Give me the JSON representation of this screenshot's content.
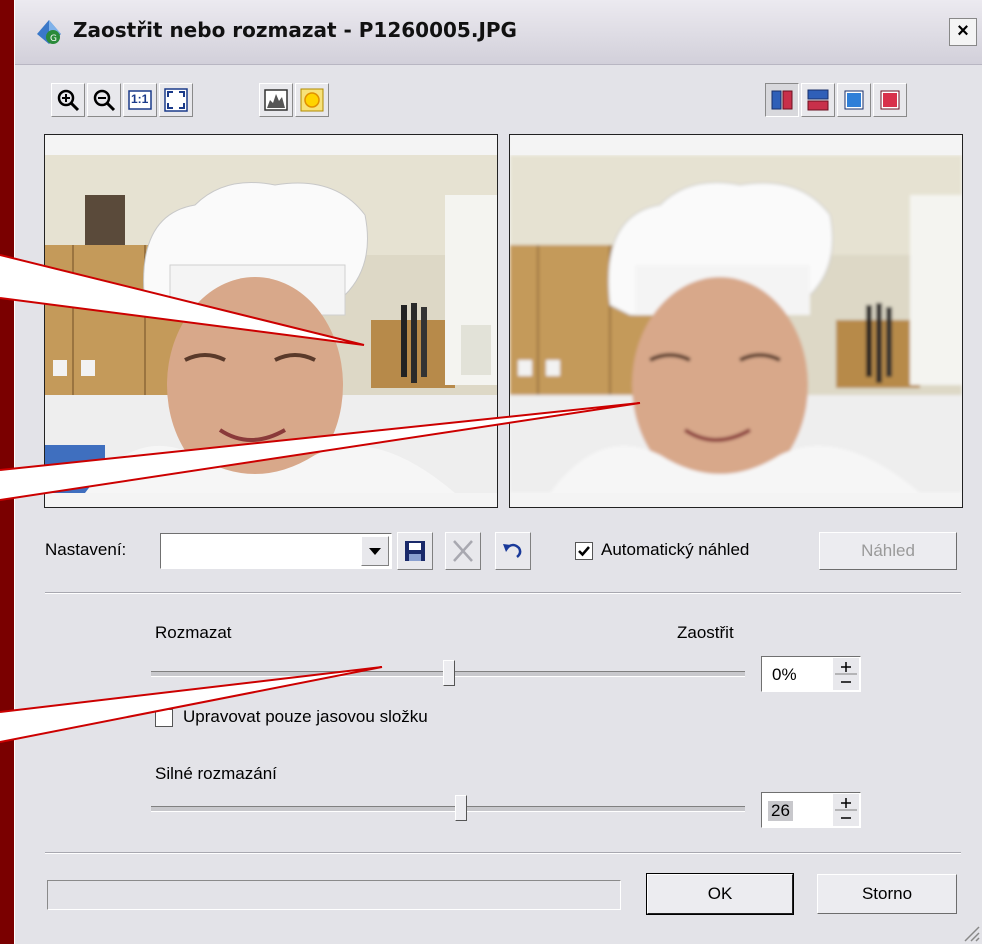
{
  "window": {
    "title": "Zaostřit nebo rozmazat - P1260005.JPG",
    "close_glyph": "×"
  },
  "toolbar": {
    "zoom_in_icon": "zoom-in-icon",
    "zoom_out_icon": "zoom-out-icon",
    "actual_size_label": "1:1",
    "fit_icon": "fit-to-window-icon",
    "histogram_icon": "histogram-icon",
    "sun_icon": "sun-icon",
    "view_icons": [
      "split-vertical-icon",
      "split-horizontal-icon",
      "single-view-blue-icon",
      "single-view-red-icon"
    ]
  },
  "settings": {
    "label": "Nastavení:",
    "preset_value": "",
    "auto_preview_label": "Automatický náhled",
    "auto_preview_checked": true,
    "preview_button": "Náhled"
  },
  "sharpen": {
    "left_label": "Rozmazat",
    "right_label": "Zaostřit",
    "value": "0%",
    "luminance_only_label": "Upravovat pouze jasovou složku",
    "luminance_only_checked": false
  },
  "strong_blur": {
    "label": "Silné rozmazání",
    "value": "26"
  },
  "footer": {
    "ok": "OK",
    "cancel": "Storno"
  },
  "colors": {
    "background": "#7a0000",
    "dialog": "#e3e3e8",
    "callout_line": "#cc0000"
  }
}
